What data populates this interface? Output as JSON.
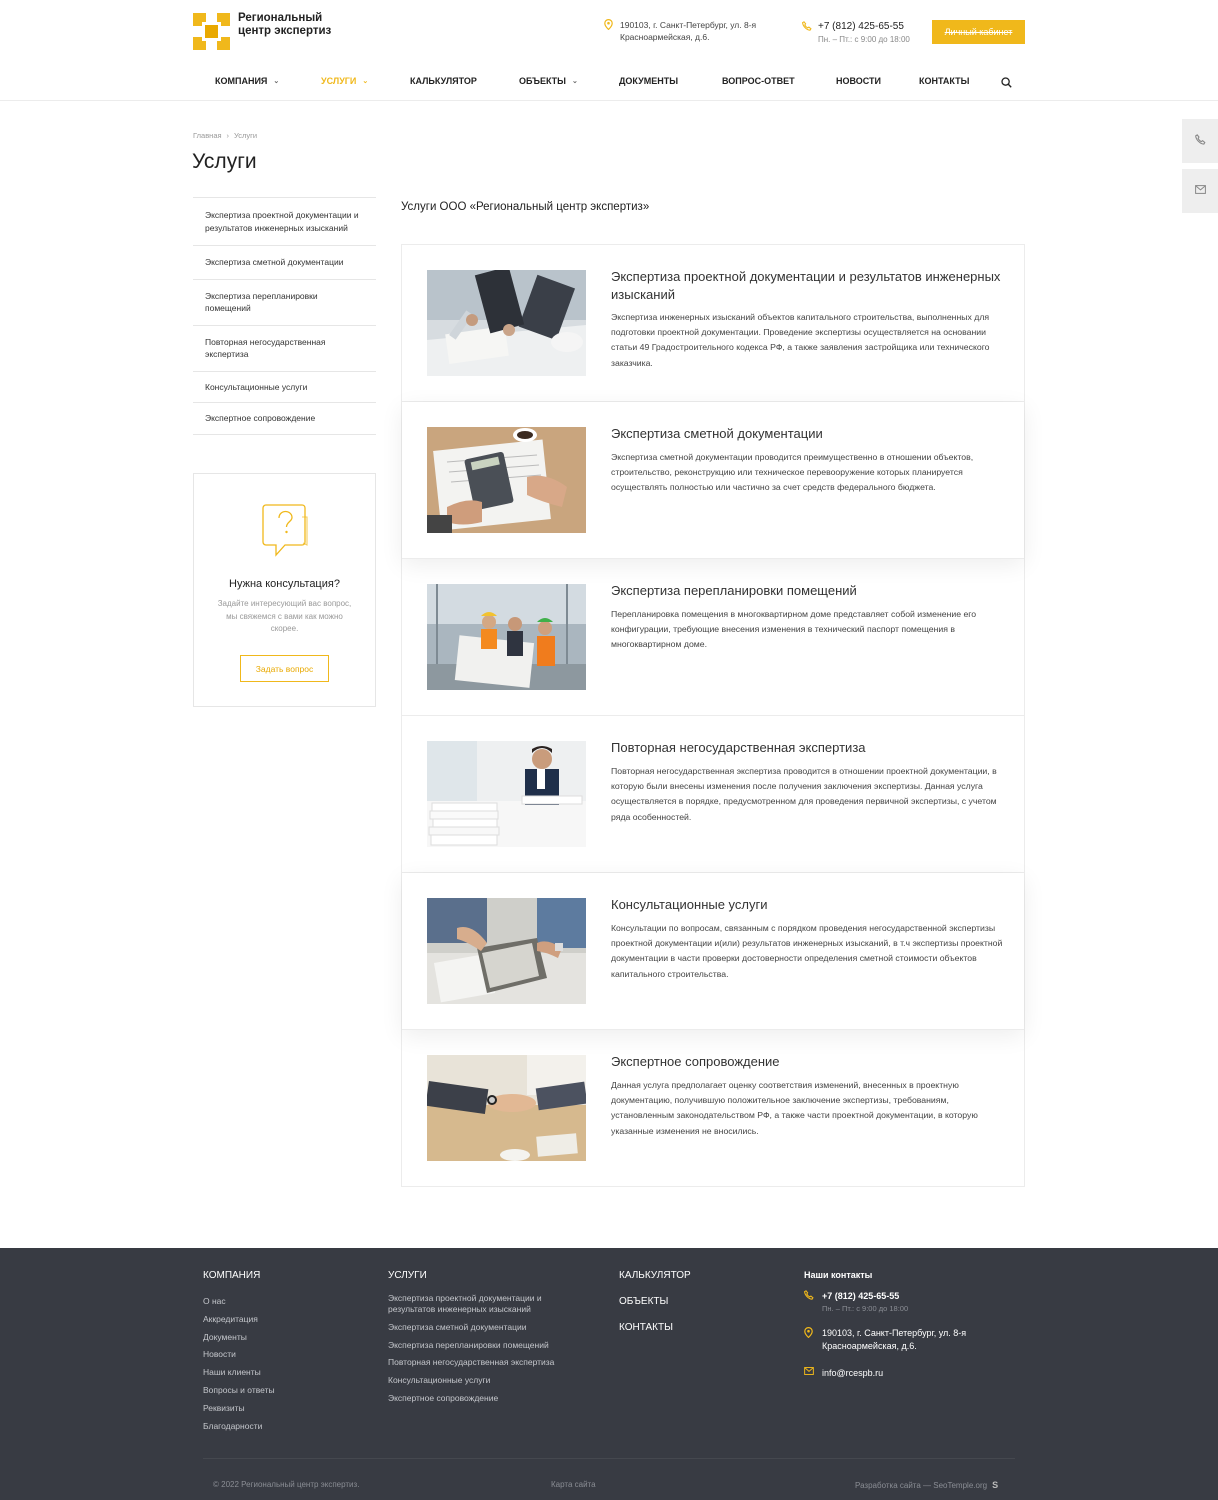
{
  "header": {
    "logo_text": "Региональный центр экспертиз",
    "address": "190103, г. Санкт-Петербург, ул. 8-я Красноармейская, д.6.",
    "phone": "+7 (812) 425-65-55",
    "hours": "Пн. – Пт.: с 9:00 до 18:00",
    "cabinet_label": "Личный кабинет",
    "accent_color": "#f0b81b"
  },
  "nav": {
    "items": [
      {
        "label": "Компания",
        "has_dropdown": true
      },
      {
        "label": "Услуги",
        "has_dropdown": true,
        "active": true
      },
      {
        "label": "Калькулятор"
      },
      {
        "label": "Объекты",
        "has_dropdown": true
      },
      {
        "label": "Документы"
      },
      {
        "label": "Вопрос-ответ"
      },
      {
        "label": "Новости"
      },
      {
        "label": "Контакты"
      }
    ]
  },
  "breadcrumb": {
    "home": "Главная",
    "current": "Услуги"
  },
  "page_title": "Услуги",
  "sidebar": {
    "items": [
      "Экспертиза проектной документации и результатов инженерных изысканий",
      "Экспертиза сметной документации",
      "Экспертиза перепланировки помещений",
      "Повторная негосударственная экспертиза",
      "Консультационные услуги",
      "Экспертное сопровождение"
    ],
    "consult": {
      "title": "Нужна консультация?",
      "text": "Задайте интересующий вас вопрос, мы свяжемся с вами как можно скорее.",
      "button": "Задать вопрос"
    }
  },
  "main": {
    "heading": "Услуги ООО «Региональный центр экспертиз»",
    "services": [
      {
        "title": "Экспертиза проектной документации и результатов инженерных изысканий",
        "description": "Экспертиза инженерных изысканий объектов капитального строительства, выполненных для подготовки проектной документации. Проведение экспертизы осуществляется на основании статьи 49 Градостроительного кодекса РФ, а также заявления застройщика или технического заказчика."
      },
      {
        "title": "Экспертиза сметной документации",
        "description": "Экспертиза сметной документации проводится преимущественно в отношении объектов, строительство, реконструкцию или техническое перевооружение которых планируется осуществлять полностью или частично за счет средств федерального бюджета."
      },
      {
        "title": "Экспертиза перепланировки помещений",
        "description": "Перепланировка помещения в многоквартирном доме представляет собой изменение его конфигурации, требующие внесения изменения в технический паспорт помещения в многоквартирном доме."
      },
      {
        "title": "Повторная негосударственная экспертиза",
        "description": "Повторная негосударственная экспертиза проводится в отношении проектной документации, в которую были внесены изменения после получения заключения экспертизы. Данная услуга осуществляется в порядке, предусмотренном для проведения первичной экспертизы, с учетом ряда особенностей."
      },
      {
        "title": "Консультационные услуги",
        "description": "Консультации по вопросам, связанным с порядком проведения негосударственной экспертизы проектной документации и(или) результатов инженерных изысканий, в т.ч экспертизы проектной документации в части проверки достоверности определения сметной стоимости объектов капитального строительства."
      },
      {
        "title": "Экспертное сопровождение",
        "description": "Данная услуга предполагает оценку соответствия изменений, внесенных в проектную документацию, получившую положительное заключение экспертизы, требованиям, установленным законодательством РФ, а также части проектной документации, в которую указанные изменения не вносились."
      }
    ]
  },
  "footer": {
    "company_head": "Компания",
    "company_links": [
      "О нас",
      "Аккредитация",
      "Документы",
      "Новости",
      "Наши клиенты",
      "Вопросы и ответы",
      "Реквизиты",
      "Благодарности"
    ],
    "services_head": "Услуги",
    "services_links": [
      "Экспертиза проектной документации и результатов инженерных изысканий",
      "Экспертиза сметной документации",
      "Экспертиза перепланировки помещений",
      "Повторная негосударственная экспертиза",
      "Консультационные услуги",
      "Экспертное сопровождение"
    ],
    "other_heads": [
      "Калькулятор",
      "Объекты",
      "Контакты"
    ],
    "contacts_title": "Наши контакты",
    "phone": "+7 (812) 425-65-55",
    "hours": "Пн. – Пт.: с 9:00 до 18:00",
    "address": "190103, г. Санкт-Петербург, ул. 8-я Красноармейская, д.6.",
    "email": "info@rcespb.ru",
    "copyright": "© 2022 Региональный центр экспертиз.",
    "sitemap": "Карта сайта",
    "developer": "Разработка сайта — SeoTemple.org"
  }
}
